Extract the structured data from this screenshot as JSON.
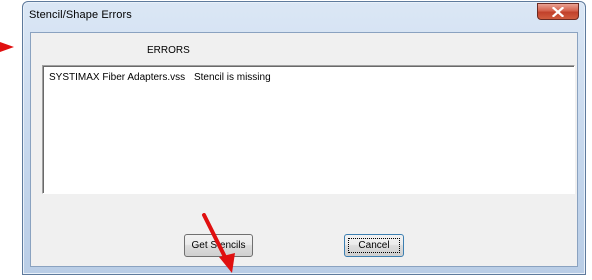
{
  "window": {
    "title": "Stencil/Shape Errors",
    "close_icon": "close-x-icon"
  },
  "errors": {
    "heading": "ERRORS",
    "rows": [
      {
        "file": "SYSTIMAX Fiber Adapters.vss",
        "message": "Stencil is missing"
      }
    ]
  },
  "buttons": {
    "get_stencils": "Get Stencils",
    "cancel": "Cancel"
  },
  "annotations": {
    "arrow_color": "#e01010",
    "arrows": [
      "left-edge-pointer-arrow",
      "get-stencils-pointer-arrow"
    ]
  }
}
